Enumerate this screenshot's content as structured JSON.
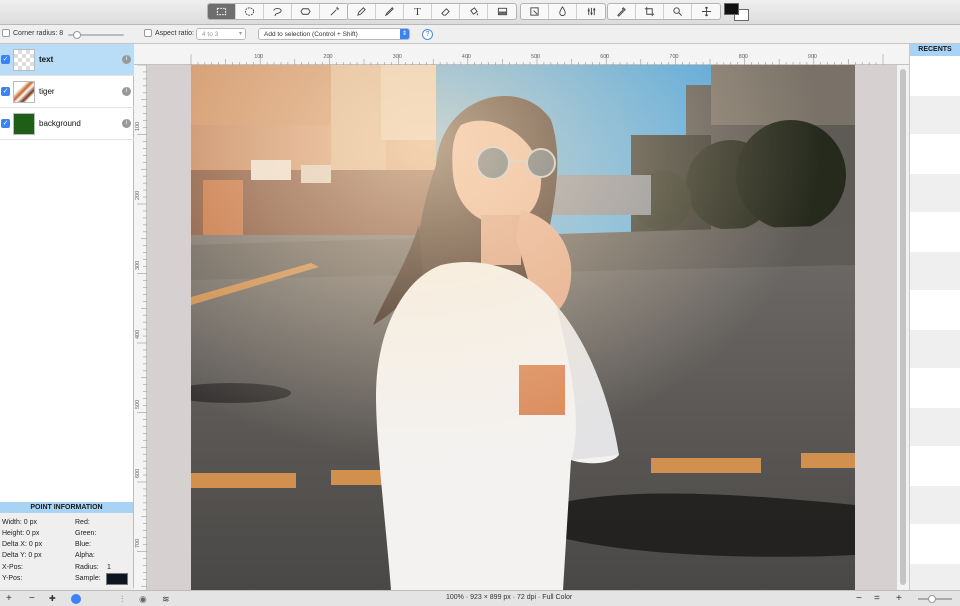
{
  "toolbar": {
    "tools": [
      {
        "icon": "rect-select-icon",
        "active": true
      },
      {
        "icon": "ellipse-select-icon"
      },
      {
        "icon": "lasso-icon"
      },
      {
        "icon": "shape-icon"
      },
      {
        "icon": "magic-wand-icon"
      },
      {
        "icon": "pen-icon"
      },
      {
        "icon": "pencil-icon"
      },
      {
        "icon": "text-tool-icon",
        "glyph": "T"
      },
      {
        "icon": "eraser-icon"
      },
      {
        "icon": "paint-bucket-icon"
      },
      {
        "icon": "gradient-icon"
      },
      {
        "icon": "clone-stamp-icon"
      },
      {
        "icon": "blur-drop-icon"
      },
      {
        "icon": "adjust-icon"
      },
      {
        "icon": "eyedropper-icon"
      },
      {
        "icon": "crop-icon"
      },
      {
        "icon": "zoom-icon"
      },
      {
        "icon": "move-icon"
      }
    ],
    "foreground_color": "#111111",
    "background_color": "#ffffff"
  },
  "options": {
    "corner_radius_label": "Corner radius: 8",
    "aspect_ratio_label": "Aspect ratio:",
    "aspect_ratio_value": "4 to 3",
    "selection_mode": "Add to selection (Control + Shift)",
    "help": "?"
  },
  "layers": [
    {
      "name": "text",
      "selected": true,
      "info": "i"
    },
    {
      "name": "tiger",
      "selected": false,
      "info": "i"
    },
    {
      "name": "background",
      "selected": false,
      "thumb_color": "#1f5e16",
      "info": "i"
    }
  ],
  "point_info": {
    "title": "POINT INFORMATION",
    "width": "Width:  0 px",
    "height": "Height:  0 px",
    "delta_x": "Delta X: 0 px",
    "delta_y": "Delta Y: 0 px",
    "x_pos": "X-Pos:",
    "y_pos": "Y-Pos:",
    "red": "Red:",
    "green": "Green:",
    "blue": "Blue:",
    "alpha": "Alpha:",
    "radius_label": "Radius:",
    "radius_value": "1",
    "sample_label": "Sample:",
    "sample_color": "#0d1520"
  },
  "bottom": {
    "add": "+",
    "remove": "−",
    "status": "100% · 923 × 899 px · 72 dpi · Full Color",
    "zoom_minus": "−",
    "zoom_fit": "=",
    "zoom_plus": "+"
  },
  "rulers": {
    "top": [
      "100",
      "200",
      "300",
      "400",
      "500",
      "600",
      "700",
      "800",
      "900"
    ],
    "left": [
      "100",
      "200",
      "300",
      "400",
      "500",
      "600",
      "700"
    ]
  },
  "recents": {
    "title": "RECENTS"
  },
  "colors": {
    "accent": "#3b82f6",
    "panel_header": "#a9d3f5",
    "selected_row": "#b9dcf7"
  }
}
